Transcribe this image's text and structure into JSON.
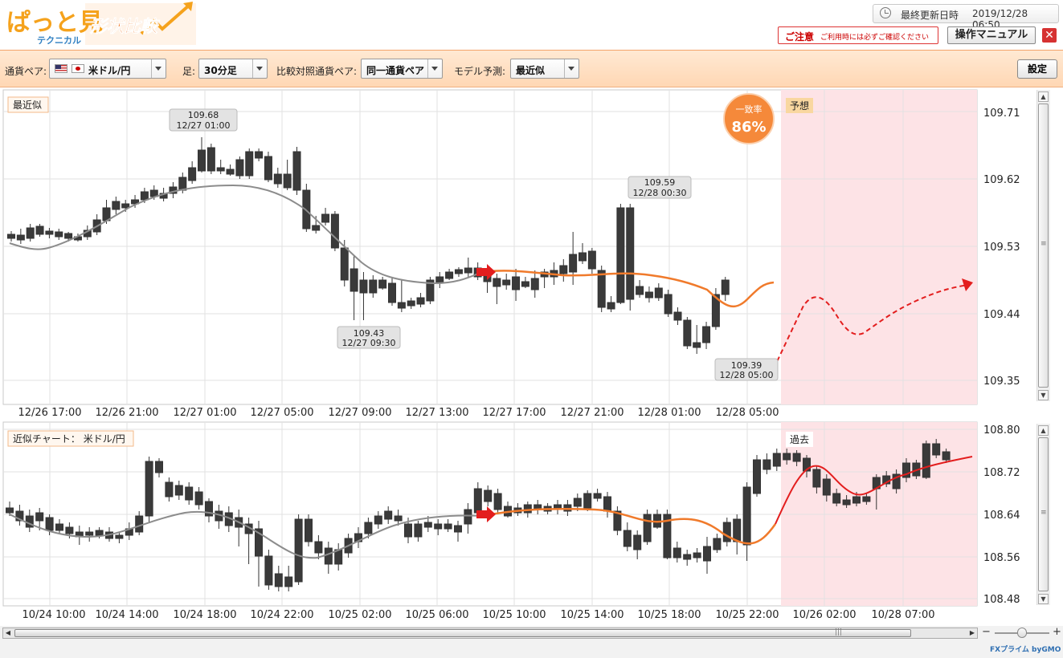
{
  "header": {
    "logo_main": "ぱっと見",
    "logo_sub": "テクニカル",
    "logo_feature": "形状比較",
    "last_update_label": "最終更新日時",
    "last_update_value": "2019/12/28 06:50",
    "caution_title": "ご注意",
    "caution_text": "ご利用時には必ずご確認ください",
    "manual_label": "操作マニュアル",
    "close_label": "✕"
  },
  "toolbar": {
    "pair_label": "通貨ペア:",
    "pair_value": "米ドル/円",
    "timeframe_label": "足:",
    "timeframe_value": "30分足",
    "compare_label": "比較対照通貨ペア:",
    "compare_value": "同一通貨ペア",
    "model_label": "モデル予測:",
    "model_value": "最近似",
    "settings_label": "設定"
  },
  "top_chart": {
    "tag": "最近似",
    "forecast_tag": "予想",
    "match_label": "一致率",
    "match_value": "86%",
    "match_fraction": 0.86,
    "y_ticks": [
      "109.71",
      "109.62",
      "109.53",
      "109.44",
      "109.35"
    ],
    "x_ticks": [
      "12/26 17:00",
      "12/26 21:00",
      "12/27 01:00",
      "12/27 05:00",
      "12/27 09:00",
      "12/27 13:00",
      "12/27 17:00",
      "12/27 21:00",
      "12/28 01:00",
      "12/28 05:00"
    ],
    "callouts": [
      {
        "price": "109.68",
        "time": "12/27 01:00"
      },
      {
        "price": "109.43",
        "time": "12/27 09:30"
      },
      {
        "price": "109.59",
        "time": "12/28 00:30"
      },
      {
        "price": "109.39",
        "time": "12/28 05:00"
      }
    ]
  },
  "bottom_chart": {
    "tag": "近似チャート： 米ドル/円",
    "past_tag": "過去",
    "y_ticks": [
      "108.80",
      "108.72",
      "108.64",
      "108.56",
      "108.48"
    ],
    "x_ticks": [
      "10/24 10:00",
      "10/24 14:00",
      "10/24 18:00",
      "10/24 22:00",
      "10/25 02:00",
      "10/25 06:00",
      "10/25 10:00",
      "10/25 14:00",
      "10/25 18:00",
      "10/25 22:00",
      "10/26 02:00",
      "10/28 07:00"
    ]
  },
  "footer": {
    "brand": "FXプライム byGMO"
  },
  "colors": {
    "accent_orange": "#f07a2b",
    "forecast_red": "#e31e1e",
    "zone_pink": "#fde3e6",
    "candle_dark": "#3a3a3a",
    "ma_gray": "#8c8c8c"
  }
}
